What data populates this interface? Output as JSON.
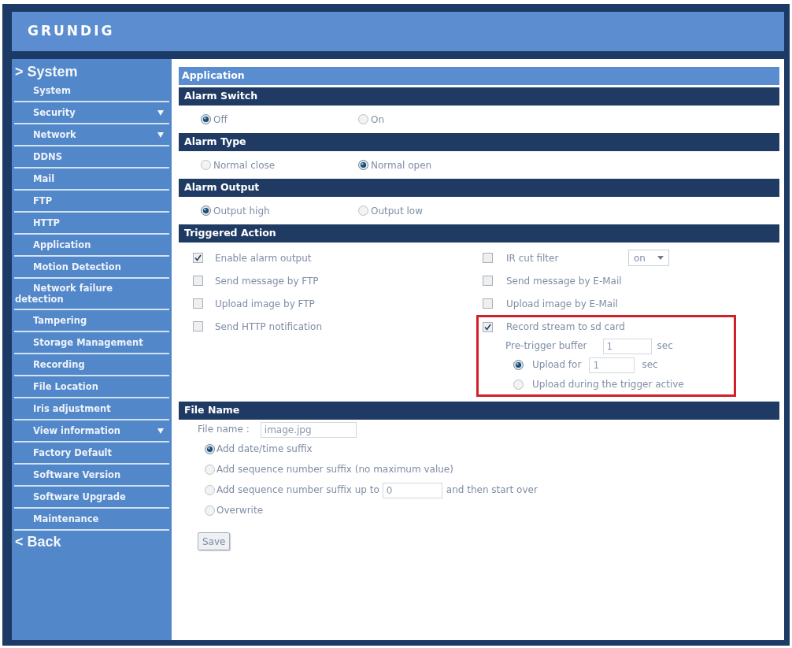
{
  "header": {
    "logo": "GRUNDIG"
  },
  "sidebar": {
    "heading": "> System",
    "items": [
      {
        "label": "System",
        "expandable": false
      },
      {
        "label": "Security",
        "expandable": true
      },
      {
        "label": "Network",
        "expandable": true
      },
      {
        "label": "DDNS",
        "expandable": false
      },
      {
        "label": "Mail",
        "expandable": false
      },
      {
        "label": "FTP",
        "expandable": false
      },
      {
        "label": "HTTP",
        "expandable": false
      },
      {
        "label": "Application",
        "expandable": false
      },
      {
        "label": "Motion Detection",
        "expandable": false
      },
      {
        "label": "Network failure detection",
        "expandable": false
      },
      {
        "label": "Tampering",
        "expandable": false
      },
      {
        "label": "Storage Management",
        "expandable": false
      },
      {
        "label": "Recording",
        "expandable": false
      },
      {
        "label": "File Location",
        "expandable": false
      },
      {
        "label": "Iris adjustment",
        "expandable": false
      },
      {
        "label": "View information",
        "expandable": true
      },
      {
        "label": "Factory Default",
        "expandable": false
      },
      {
        "label": "Software Version",
        "expandable": false
      },
      {
        "label": "Software Upgrade",
        "expandable": false
      },
      {
        "label": "Maintenance",
        "expandable": false
      }
    ],
    "back": "< Back"
  },
  "page_title": "Application",
  "sections": [
    {
      "kind": "radios",
      "title": "Alarm Switch",
      "options": [
        {
          "label": "Off",
          "selected": true
        },
        {
          "label": "On",
          "selected": false
        }
      ]
    },
    {
      "kind": "radios",
      "title": "Alarm Type",
      "options": [
        {
          "label": "Normal close",
          "selected": false
        },
        {
          "label": "Normal open",
          "selected": true
        }
      ]
    },
    {
      "kind": "radios",
      "title": "Alarm Output",
      "options": [
        {
          "label": "Output high",
          "selected": true
        },
        {
          "label": "Output low",
          "selected": false
        }
      ]
    },
    {
      "kind": "actions",
      "title": "Triggered Action",
      "left": [
        {
          "label": "Enable alarm output",
          "checked": true
        },
        {
          "label": "Send message by FTP",
          "checked": false
        },
        {
          "label": "Upload image by FTP",
          "checked": false
        },
        {
          "label": "Send HTTP notification",
          "checked": false
        }
      ],
      "right": [
        {
          "label": "IR cut filter",
          "checked": false,
          "select": "on"
        },
        {
          "label": "Send message by E-Mail",
          "checked": false
        },
        {
          "label": "Upload image by E-Mail",
          "checked": false
        },
        {
          "label": "Record stream to sd card",
          "checked": true,
          "highlighted": true,
          "pre_trigger": {
            "label": "Pre-trigger buffer",
            "value": "1",
            "unit": "sec"
          },
          "upload_options": [
            {
              "label": "Upload for",
              "value": "1",
              "unit": "sec",
              "selected": true
            },
            {
              "label": "Upload during the trigger active",
              "selected": false
            }
          ]
        }
      ]
    },
    {
      "kind": "file_name",
      "title": "File Name",
      "file_name": {
        "label": "File name :",
        "value": "image.jpg"
      },
      "options": [
        {
          "label": "Add date/time suffix",
          "selected": true
        },
        {
          "label": "Add sequence number suffix (no maximum value)",
          "selected": false
        },
        {
          "label": "Add sequence number suffix up to",
          "value": "0",
          "suffix": "and then start over",
          "selected": false
        },
        {
          "label": "Overwrite",
          "selected": false
        }
      ],
      "save": "Save"
    }
  ]
}
